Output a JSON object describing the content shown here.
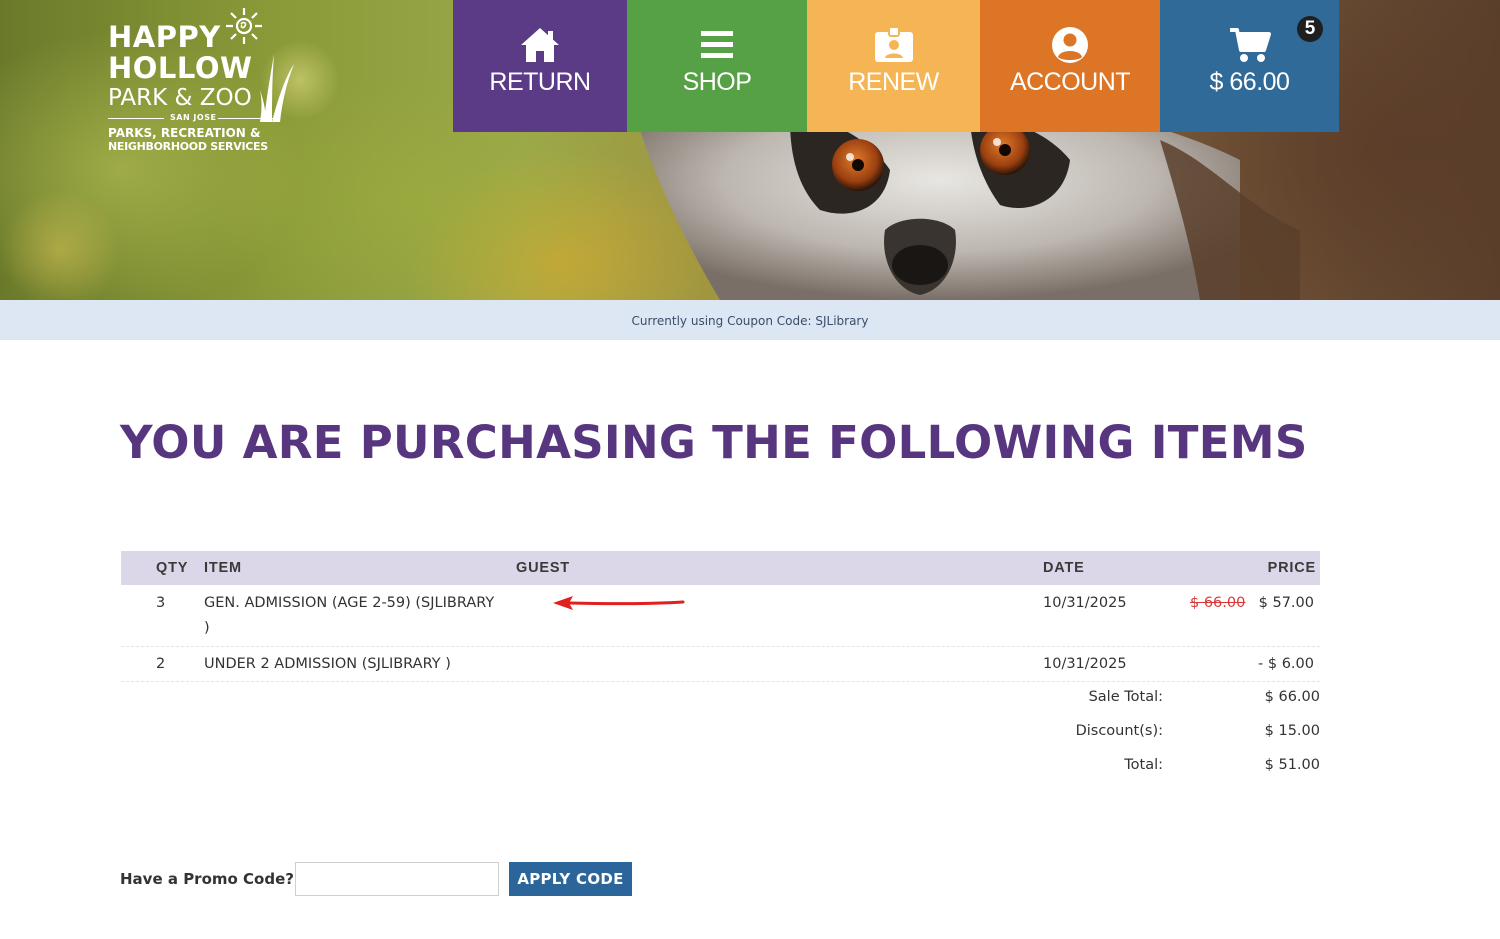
{
  "logo": {
    "line1": "HAPPY",
    "line2": "HOLLOW",
    "line3": "PARK & ZOO",
    "line4": "SAN JOSE",
    "line5": "PARKS, RECREATION &",
    "line6": "NEIGHBORHOOD SERVICES"
  },
  "nav": {
    "return_label": "RETURN",
    "return_icon": "home-icon",
    "shop_label": "SHOP",
    "shop_icon": "menu-icon",
    "renew_label": "RENEW",
    "renew_icon": "id-badge-icon",
    "account_label": "ACCOUNT",
    "account_icon": "user-circle-icon",
    "cart_label": "$ 66.00",
    "cart_icon": "cart-icon",
    "cart_count": "5"
  },
  "colors": {
    "return": "#5b3a86",
    "shop": "#56a045",
    "renew": "#f6b555",
    "account": "#dc7526",
    "cart": "#2f6a98",
    "heading": "#57357f",
    "strike": "#d83a3a",
    "apply_button": "#2b659a"
  },
  "coupon_bar": "Currently using Coupon Code: SJLibrary",
  "heading": "YOU ARE PURCHASING THE FOLLOWING ITEMS",
  "table": {
    "headers": {
      "qty": "QTY",
      "item": "ITEM",
      "guest": "GUEST",
      "date": "DATE",
      "price": "PRICE"
    },
    "rows": [
      {
        "qty": "3",
        "item_line1": "GEN. ADMISSION (AGE 2-59) (SJLIBRARY",
        "item_line2": ")",
        "date": "10/31/2025",
        "old_price": "$ 66.00",
        "price": "$ 57.00"
      },
      {
        "qty": "2",
        "item_line1": "UNDER 2 ADMISSION (SJLIBRARY )",
        "date": "10/31/2025",
        "price": "- $ 6.00"
      }
    ]
  },
  "totals": {
    "sale_total_label": "Sale Total:",
    "sale_total": "$ 66.00",
    "discounts_label": "Discount(s):",
    "discounts": "$ 15.00",
    "total_label": "Total:",
    "total": "$ 51.00"
  },
  "promo": {
    "label": "Have a Promo Code?",
    "input_value": "",
    "button_label": "APPLY CODE"
  }
}
